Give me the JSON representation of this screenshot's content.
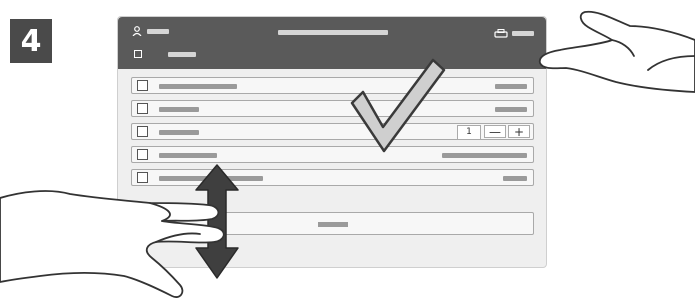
{
  "step": {
    "number": "4"
  },
  "colors": {
    "header": "#5a5a5a",
    "panel": "#efefef",
    "row_border": "#a9a9a9",
    "check": "#3a3a3a"
  },
  "header": {
    "user_icon": "person-icon",
    "printer_icon": "printer-icon",
    "sub_icon": "document-icon"
  },
  "rows": [
    {
      "icon": "document-icon"
    },
    {
      "icon": "copies-icon"
    },
    {
      "icon": "quantity-icon",
      "quantity": "1",
      "minus": "—",
      "plus": "+"
    },
    {
      "icon": "list-icon"
    },
    {
      "icon": "output-icon"
    }
  ],
  "overlay": {
    "check_icon": "check-mark-icon",
    "scroll_icon": "up-down-arrow-icon",
    "hand_icons": [
      "hand-right-icon",
      "hand-left-icon"
    ]
  }
}
